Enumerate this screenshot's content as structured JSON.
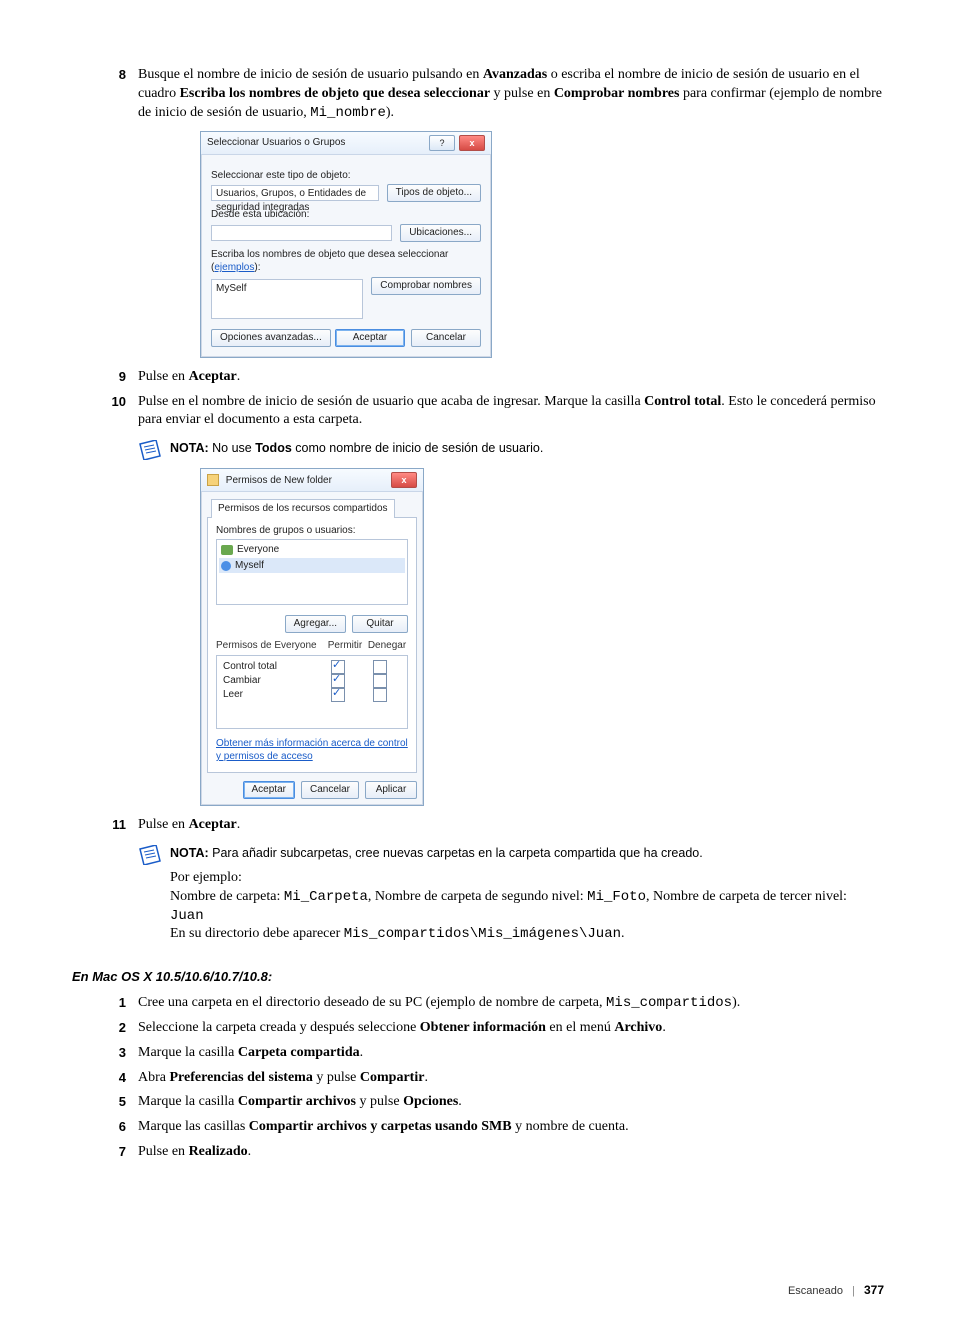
{
  "step8": {
    "num": "8",
    "t1": "Busque el nombre de inicio de sesión de usuario pulsando en ",
    "b1": "Avanzadas",
    "t2": " o escriba el nombre de inicio de sesión de usuario en el cuadro ",
    "b2": "Escriba los nombres de objeto que desea seleccionar",
    "t3": " y pulse en ",
    "b3": "Comprobar nombres",
    "t4": " para confirmar (ejemplo de nombre de inicio de sesión de usuario, ",
    "code1": "Mi_nombre",
    "t5": ")."
  },
  "dialog1": {
    "title": "Seleccionar Usuarios o Grupos",
    "lbl_tipo": "Seleccionar este tipo de objeto:",
    "val_tipo": "Usuarios, Grupos, o Entidades de seguridad integradas",
    "btn_tipos": "Tipos de objeto...",
    "lbl_ubic": "Desde esta ubicación:",
    "val_ubic": "",
    "btn_ubic": "Ubicaciones...",
    "lbl_names_a": "Escriba los nombres de objeto que desea seleccionar (",
    "lbl_names_link": "ejemplos",
    "lbl_names_b": "):",
    "val_names": "MySelf",
    "btn_check": "Comprobar nombres",
    "btn_adv": "Opciones avanzadas...",
    "btn_ok": "Aceptar",
    "btn_cancel": "Cancelar"
  },
  "step9": {
    "num": "9",
    "t1": "Pulse en ",
    "b1": "Aceptar",
    "t2": "."
  },
  "step10": {
    "num": "10",
    "t1": "Pulse en el nombre de inicio de sesión de usuario que acaba de ingresar. Marque la casilla ",
    "b1": "Control total",
    "t2": ". Esto le concederá permiso para enviar el documento a esta carpeta."
  },
  "note1": {
    "label": "NOTA:",
    "t1": " No use ",
    "b1": "Todos",
    "t2": " como nombre de inicio de sesión de usuario."
  },
  "dialog2": {
    "title": "Permisos de New folder",
    "tab": "Permisos de los recursos compartidos",
    "lbl_groups": "Nombres de grupos o usuarios:",
    "item_everyone": "Everyone",
    "item_myself": "Myself",
    "btn_add": "Agregar...",
    "btn_remove": "Quitar",
    "lbl_permfor": "Permisos de Everyone",
    "col_allow": "Permitir",
    "col_deny": "Denegar",
    "perm_full": "Control total",
    "perm_change": "Cambiar",
    "perm_read": "Leer",
    "link": "Obtener más información acerca de control y permisos de acceso",
    "btn_ok": "Aceptar",
    "btn_cancel": "Cancelar",
    "btn_apply": "Aplicar"
  },
  "step11": {
    "num": "11",
    "t1": "Pulse en ",
    "b1": "Aceptar",
    "t2": "."
  },
  "note2": {
    "label": "NOTA:",
    "t1": " Para añadir subcarpetas, cree nuevas carpetas en la carpeta compartida que ha creado.",
    "line_ej": "Por ejemplo:",
    "line2a": "Nombre de carpeta: ",
    "line2code1": "Mi_Carpeta",
    "line2b": ", Nombre de carpeta de segundo nivel: ",
    "line2code2": "Mi_Foto",
    "line2c": ", Nombre de carpeta de tercer nivel: ",
    "line2code3": "Juan",
    "line3a": "En su directorio debe aparecer ",
    "line3code": "Mis_compartidos\\Mis_imágenes\\Juan",
    "line3b": "."
  },
  "mac_heading": "En Mac OS X 10.5/10.6/10.7/10.8:",
  "mac_steps": {
    "s1": {
      "num": "1",
      "t1": "Cree una carpeta en el directorio deseado de su PC (ejemplo de nombre de carpeta, ",
      "code": "Mis_compartidos",
      "t2": ")."
    },
    "s2": {
      "num": "2",
      "t1": "Seleccione la carpeta creada y después seleccione ",
      "b1": "Obtener información",
      "t2": " en el menú ",
      "b2": "Archivo",
      "t3": "."
    },
    "s3": {
      "num": "3",
      "t1": "Marque la casilla ",
      "b1": "Carpeta compartida",
      "t2": "."
    },
    "s4": {
      "num": "4",
      "t1": "Abra ",
      "b1": "Preferencias del sistema",
      "t2": " y pulse ",
      "b2": "Compartir",
      "t3": "."
    },
    "s5": {
      "num": "5",
      "t1": "Marque la casilla ",
      "b1": "Compartir archivos",
      "t2": " y pulse ",
      "b2": "Opciones",
      "t3": "."
    },
    "s6": {
      "num": "6",
      "t1": "Marque las casillas ",
      "b1": "Compartir archivos y carpetas usando SMB",
      "t2": " y nombre de cuenta."
    },
    "s7": {
      "num": "7",
      "t1": "Pulse en ",
      "b1": "Realizado",
      "t2": "."
    }
  },
  "footer": {
    "section": "Escaneado",
    "page": "377"
  }
}
